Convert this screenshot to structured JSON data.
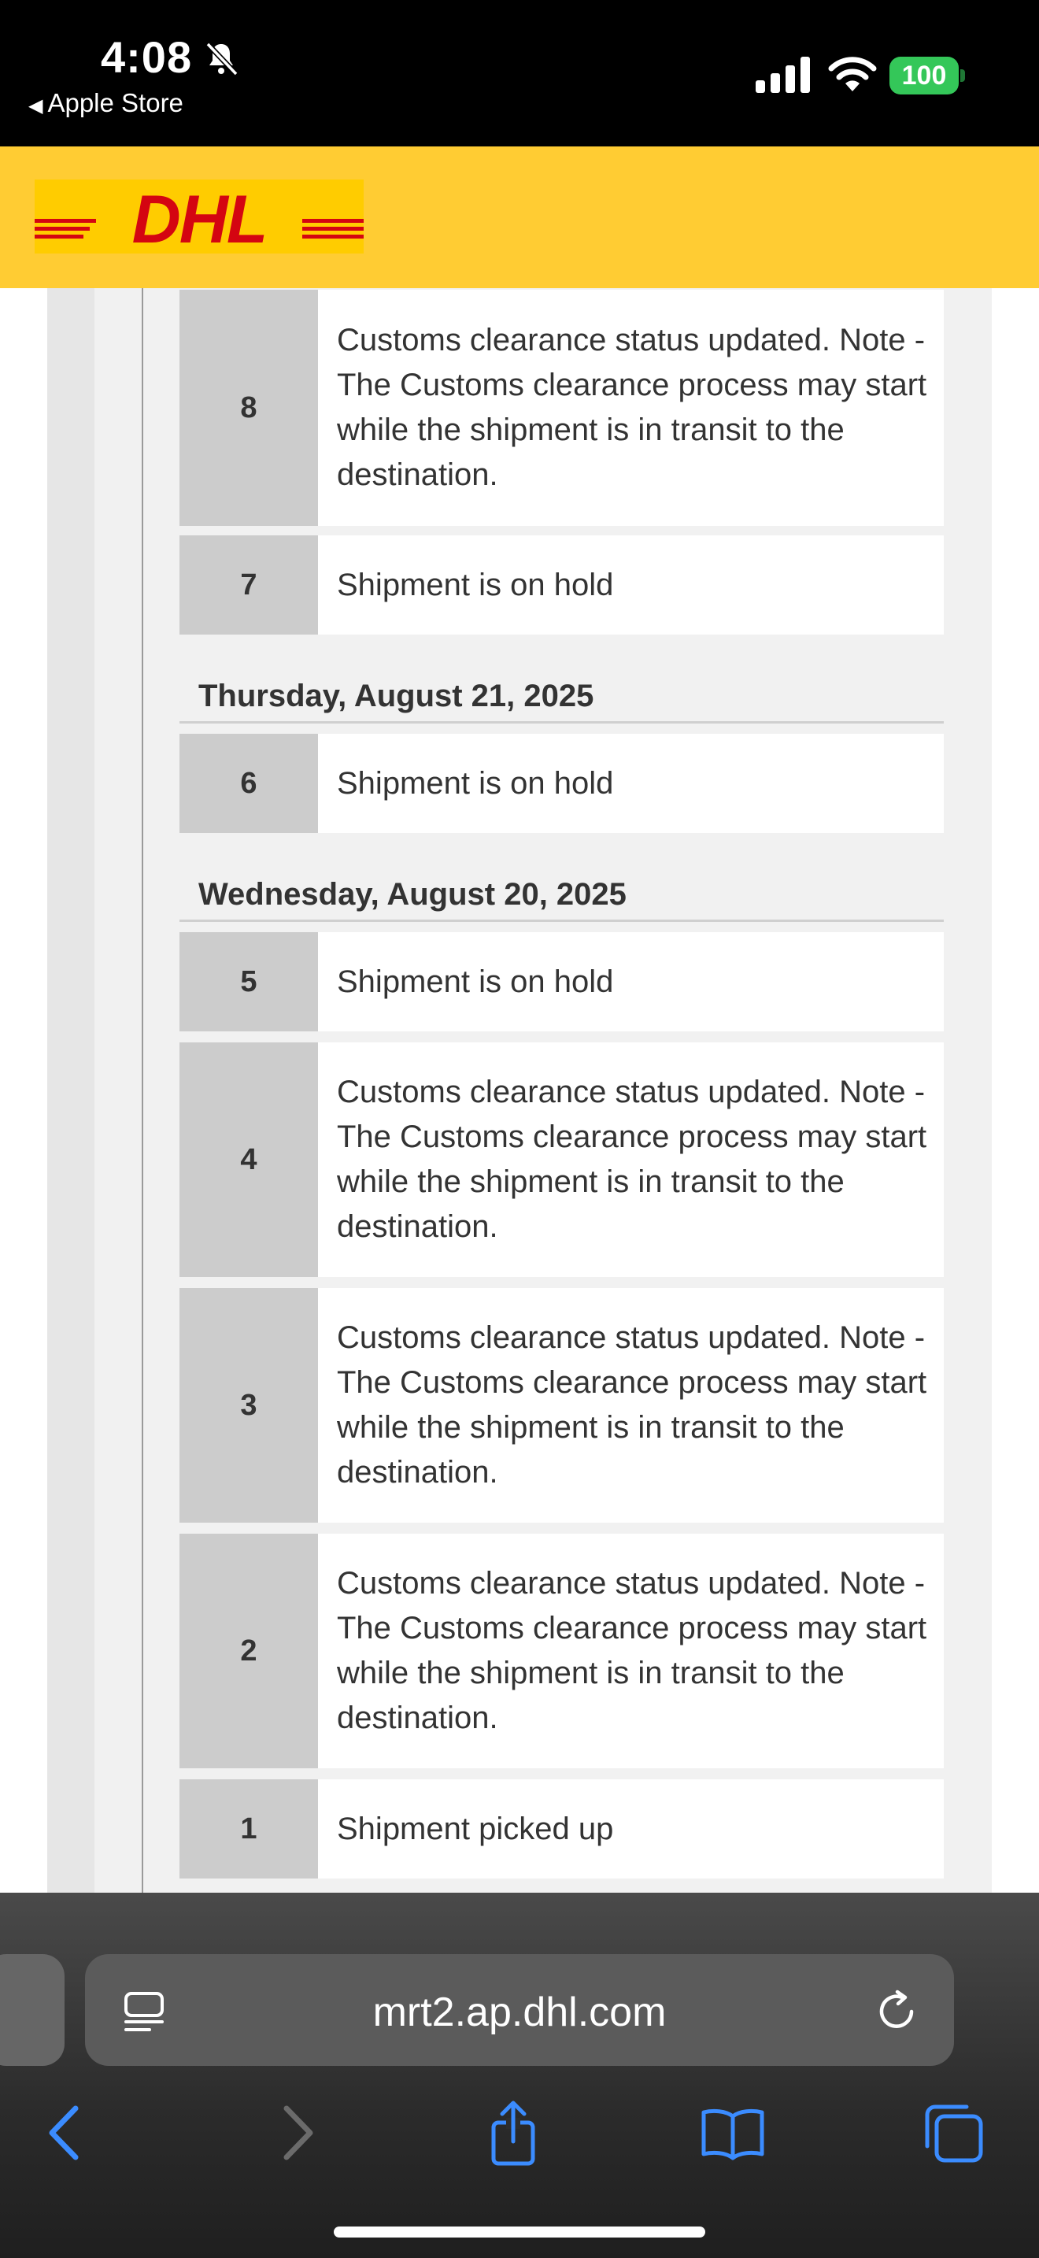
{
  "status_bar": {
    "time": "4:08",
    "back_app": "Apple Store",
    "battery": "100"
  },
  "brand": {
    "logo_text": "DHL",
    "red": "#d40511",
    "yellow": "#ffcc00"
  },
  "events": [
    {
      "num": "8",
      "text": "Customs clearance status updated. Note - The Customs clearance process may start while the shipment is in transit to the destination."
    },
    {
      "num": "7",
      "text": "Shipment is on hold"
    },
    {
      "num": "6",
      "text": "Shipment is on hold"
    },
    {
      "num": "5",
      "text": "Shipment is on hold"
    },
    {
      "num": "4",
      "text": "Customs clearance status updated. Note - The Customs clearance process may start while the shipment is in transit to the destination."
    },
    {
      "num": "3",
      "text": "Customs clearance status updated. Note - The Customs clearance process may start while the shipment is in transit to the destination."
    },
    {
      "num": "2",
      "text": "Customs clearance status updated. Note - The Customs clearance process may start while the shipment is in transit to the destination."
    },
    {
      "num": "1",
      "text": "Shipment picked up"
    }
  ],
  "date_headers": [
    "Thursday, August 21, 2025",
    "Wednesday, August 20, 2025"
  ],
  "browser": {
    "url": "mrt2.ap.dhl.com",
    "toolbar_icons": [
      "back-icon",
      "forward-icon",
      "share-icon",
      "bookmarks-icon",
      "tabs-icon"
    ]
  }
}
